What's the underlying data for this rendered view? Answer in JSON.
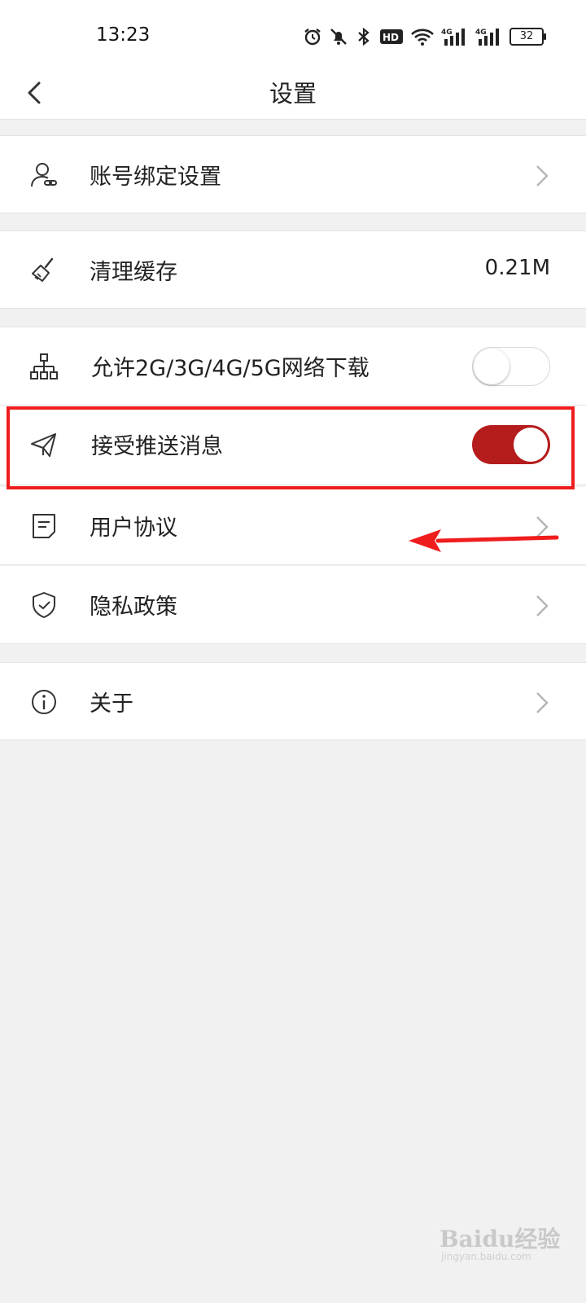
{
  "status_bar": {
    "time": "13:23",
    "hd_label": "HD",
    "net1": "4G",
    "net2": "4G",
    "battery": "32"
  },
  "header": {
    "title": "设置"
  },
  "settings": {
    "account": {
      "label": "账号绑定设置"
    },
    "cache": {
      "label": "清理缓存",
      "value": "0.21M"
    },
    "mobile_download": {
      "label": "允许2G/3G/4G/5G网络下载",
      "enabled": false
    },
    "push": {
      "label": "接受推送消息",
      "enabled": true
    },
    "agreement": {
      "label": "用户协议"
    },
    "privacy": {
      "label": "隐私政策"
    },
    "about": {
      "label": "关于"
    }
  },
  "watermark": {
    "text": "Baidu经验",
    "sub": "jingyan.baidu.com"
  },
  "colors": {
    "toggle_on": "#b51c1c",
    "annotation": "#f01d1d",
    "background": "#f1f1f1"
  }
}
